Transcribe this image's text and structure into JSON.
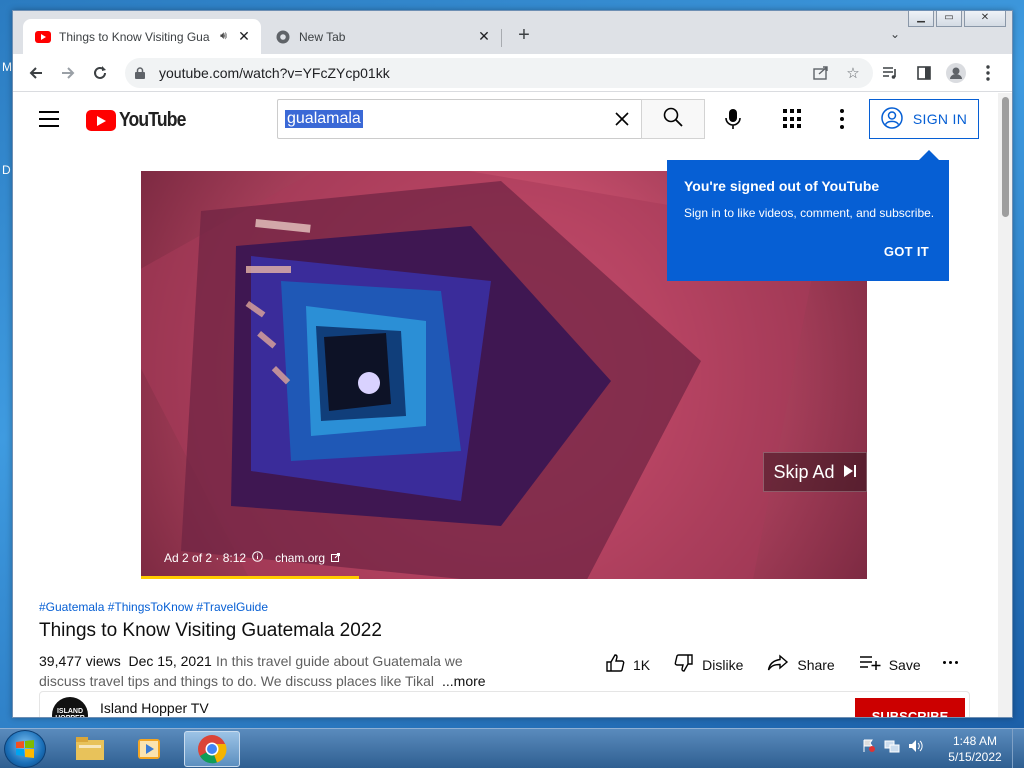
{
  "browser": {
    "tabs": [
      {
        "title": "Things to Know Visiting Gua",
        "active": true
      },
      {
        "title": "New Tab",
        "active": false
      }
    ],
    "url": "youtube.com/watch?v=YFcZYcp01kk"
  },
  "youtube": {
    "logo_text": "YouTube",
    "search_query": "gualamala",
    "sign_in_label": "SIGN IN",
    "tooltip": {
      "title": "You're signed out of YouTube",
      "body": "Sign in to like videos, comment, and subscribe.",
      "button": "GOT IT"
    },
    "ad": {
      "skip_label": "Skip Ad",
      "info": "Ad 2 of 2 · 8:12",
      "domain": "cham.org",
      "progress": 0.3
    },
    "video": {
      "hashtags": "#Guatemala #ThingsToKnow #TravelGuide",
      "title": "Things to Know Visiting Guatemala 2022",
      "views": "39,477 views",
      "date": "Dec 15, 2021",
      "desc_line1": "In this travel guide about Guatemala we",
      "desc_line2": "discuss travel tips and things to do. We discuss places like Tikal",
      "more": "...more",
      "likes": "1K",
      "dislike_label": "Dislike",
      "share_label": "Share",
      "save_label": "Save"
    },
    "channel": {
      "name": "Island Hopper TV",
      "avatar_text": "ISLAND HOPPER",
      "subscribe_label": "SUBSCRIBE"
    }
  },
  "taskbar": {
    "time": "1:48 AM",
    "date": "5/15/2022"
  },
  "colors": {
    "yt_red": "#ff0000",
    "yt_blue": "#065fd4",
    "ad_progress": "#ffcc00"
  }
}
